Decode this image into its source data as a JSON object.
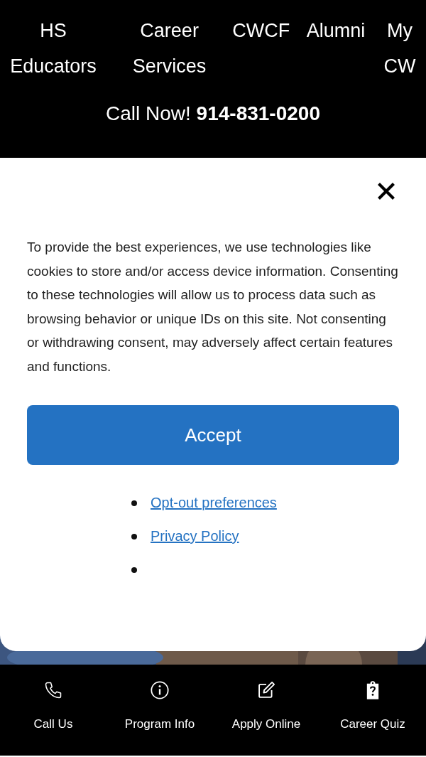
{
  "nav": [
    {
      "label": "HS Educators"
    },
    {
      "label": "Career Services"
    },
    {
      "label": "CWCF"
    },
    {
      "label": "Alumni"
    },
    {
      "label": "My CW"
    }
  ],
  "call_now": {
    "text": "Call Now! **914-831-0200**"
  },
  "consent_dialog": {
    "message": "To provide the best experiences, we use technologies like cookies to store and/or access device information. Consenting to these technologies will allow us to process data such as browsing behavior or unique IDs on this site. Not consenting or withdrawing consent, may adversely affect certain features and functions.",
    "accept_button": "Accept",
    "links": [
      {
        "kind": "link",
        "label": "Opt-out preferences"
      },
      {
        "kind": "link",
        "label": "Privacy Policy"
      },
      {
        "kind": "blank"
      }
    ]
  },
  "bottom_bar": [
    {
      "kind": "phone",
      "label": "Call Us"
    },
    {
      "kind": "info",
      "label": "Program Info"
    },
    {
      "kind": "edit",
      "label": "Apply Online"
    },
    {
      "kind": "quiz",
      "label": "Career Quiz"
    }
  ]
}
